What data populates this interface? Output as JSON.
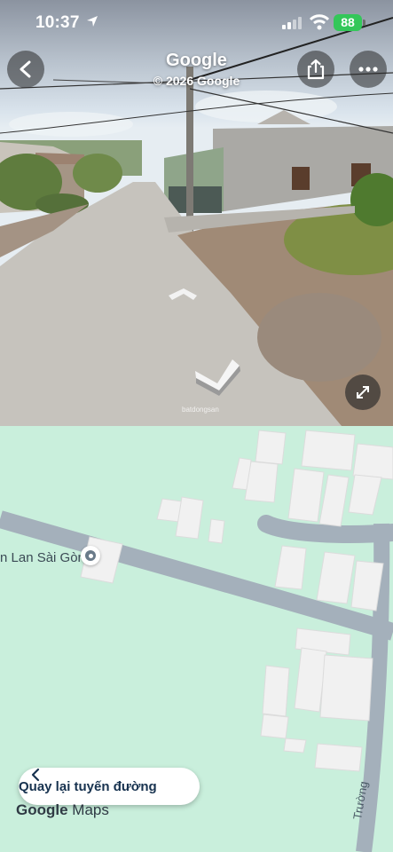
{
  "status_bar": {
    "time": "10:37",
    "battery": "88"
  },
  "street_view": {
    "title": "Google",
    "copyright": "© 2026 Google",
    "watermark": "batdongsan"
  },
  "map": {
    "place_label": "n Lan Sài Gòn",
    "road_label": "Trường",
    "back_button_label": "Quay lại tuyến đường",
    "brand_google": "Google",
    "brand_maps": "Maps"
  },
  "colors": {
    "map_bg": "#c9efdc",
    "road": "#a4b0bb",
    "building": "#f1f1f1",
    "battery": "#33c759"
  }
}
